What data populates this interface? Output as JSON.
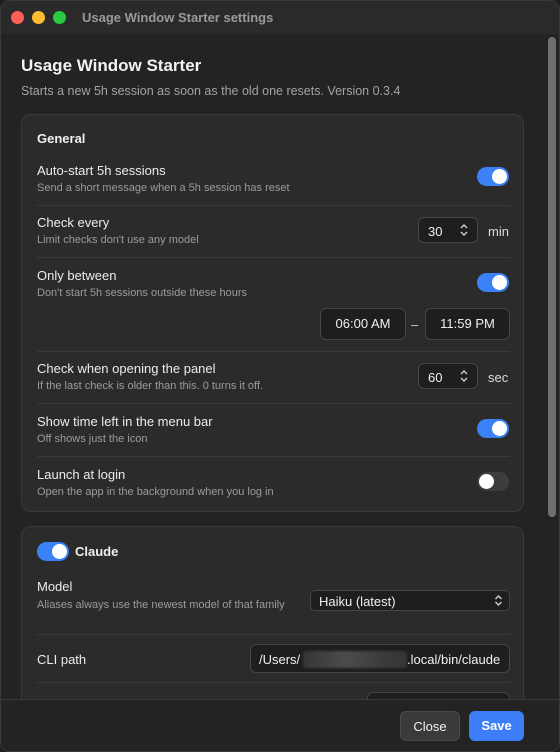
{
  "window": {
    "title": "Usage Window Starter settings"
  },
  "header": {
    "app_name": "Usage Window Starter",
    "subtitle": "Starts a new 5h session as soon as the old one resets. Version 0.3.4"
  },
  "general": {
    "title": "General",
    "auto_start": {
      "label": "Auto-start 5h sessions",
      "desc": "Send a short message when a 5h session has reset",
      "on": true
    },
    "check_every": {
      "label": "Check every",
      "desc": "Limit checks don't use any model",
      "value": "30",
      "unit": "min"
    },
    "only_between": {
      "label": "Only between",
      "desc": "Don't start 5h sessions outside these hours",
      "on": true,
      "start": "06:00 AM",
      "separator": "–",
      "end": "11:59 PM"
    },
    "check_on_open": {
      "label": "Check when opening the panel",
      "desc": "If the last check is older than this. 0 turns it off.",
      "value": "60",
      "unit": "sec"
    },
    "menu_bar": {
      "label": "Show time left in the menu bar",
      "desc": "Off shows just the icon",
      "on": true
    },
    "launch_login": {
      "label": "Launch at login",
      "desc": "Open the app in the background when you log in",
      "on": false
    }
  },
  "claude": {
    "title": "Claude",
    "enabled": true,
    "model": {
      "label": "Model",
      "desc": "Aliases always use the newest model of that family",
      "value": "Haiku (latest)"
    },
    "cli_path": {
      "label": "CLI path",
      "value_prefix": "/Users/",
      "value_suffix": ".local/bin/claude"
    }
  },
  "footer": {
    "close_label": "Close",
    "save_label": "Save"
  },
  "colors": {
    "accent": "#3b82f6",
    "save": "#3d7df5",
    "toggle_off": "#3d3d3d"
  }
}
